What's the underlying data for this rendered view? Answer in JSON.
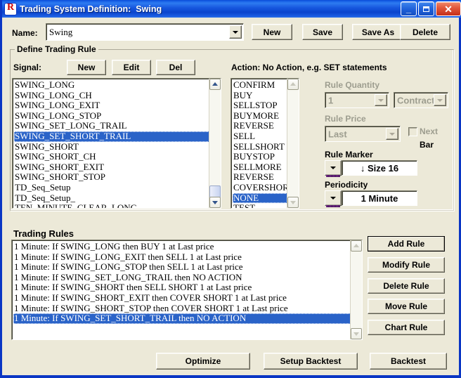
{
  "window": {
    "title": "Trading System Definition:  Swing",
    "icon": "app-r-icon",
    "minimize_label": "_",
    "maximize_label": "",
    "close_label": "✕"
  },
  "name_row": {
    "label": "Name:",
    "value": "Swing",
    "buttons": [
      "New",
      "Save",
      "Save As",
      "Delete"
    ]
  },
  "define_group": {
    "title": "Define Trading Rule",
    "signal_label": "Signal:",
    "signal_buttons": [
      "New",
      "Edit",
      "Del"
    ],
    "action_label": "Action: No Action, e.g. SET statements",
    "signals": [
      "SWING_LONG",
      "SWING_LONG_CH",
      "SWING_LONG_EXIT",
      "SWING_LONG_STOP",
      "SWING_SET_LONG_TRAIL",
      "SWING_SET_SHORT_TRAIL",
      "SWING_SHORT",
      "SWING_SHORT_CH",
      "SWING_SHORT_EXIT",
      "SWING_SHORT_STOP",
      "TD_Seq_Setup",
      "TD_Seq_Setup_",
      "TEN_MINUTE_CLEAR_LONG"
    ],
    "signal_selected_index": 5,
    "actions": [
      "CONFIRM",
      "BUY",
      "SELLSTOP",
      "BUYMORE",
      "REVERSE",
      "SELL",
      "SELLSHORT",
      "BUYSTOP",
      "SELLMORE",
      "REVERSE",
      "COVERSHORT",
      "NONE",
      "TEST"
    ],
    "action_selected_index": 11,
    "rule_quantity_label": "Rule Quantity",
    "rule_quantity_value": "1",
    "rule_quantity_unit": "Contracts",
    "rule_price_label": "Rule Price",
    "rule_price_value": "Last",
    "next_bar_label_line1": "Next",
    "next_bar_label_line2": "Bar",
    "rule_marker_label": "Rule Marker",
    "rule_marker_value": "↓ Size 16",
    "periodicity_label": "Periodicity",
    "periodicity_value": "1 Minute"
  },
  "trading_rules": {
    "title": "Trading Rules",
    "rules": [
      "1 Minute: If SWING_LONG then BUY 1 at Last price",
      "1 Minute: If SWING_LONG_EXIT then SELL 1 at Last price",
      "1 Minute: If SWING_LONG_STOP then SELL 1 at Last price",
      "1 Minute: If SWING_SET_LONG_TRAIL then NO ACTION",
      "1 Minute: If SWING_SHORT then SELL SHORT 1 at Last price",
      "1 Minute: If SWING_SHORT_EXIT then COVER SHORT 1 at Last price",
      "1 Minute: If SWING_SHORT_STOP then COVER SHORT 1 at Last price",
      "1 Minute: If SWING_SET_SHORT_TRAIL then NO ACTION"
    ],
    "selected_index": 7,
    "buttons": [
      "Add Rule",
      "Modify Rule",
      "Delete Rule",
      "Move Rule",
      "Chart Rule"
    ]
  },
  "footer": {
    "buttons": [
      "Optimize",
      "Setup Backtest",
      "Backtest"
    ]
  },
  "colors": {
    "window_border": "#0A36C4",
    "dialog_background": "#ECE9D8",
    "selection": "#2A63C8",
    "title_text": "#FFFFFF",
    "disabled_text": "#9D9D8F"
  }
}
